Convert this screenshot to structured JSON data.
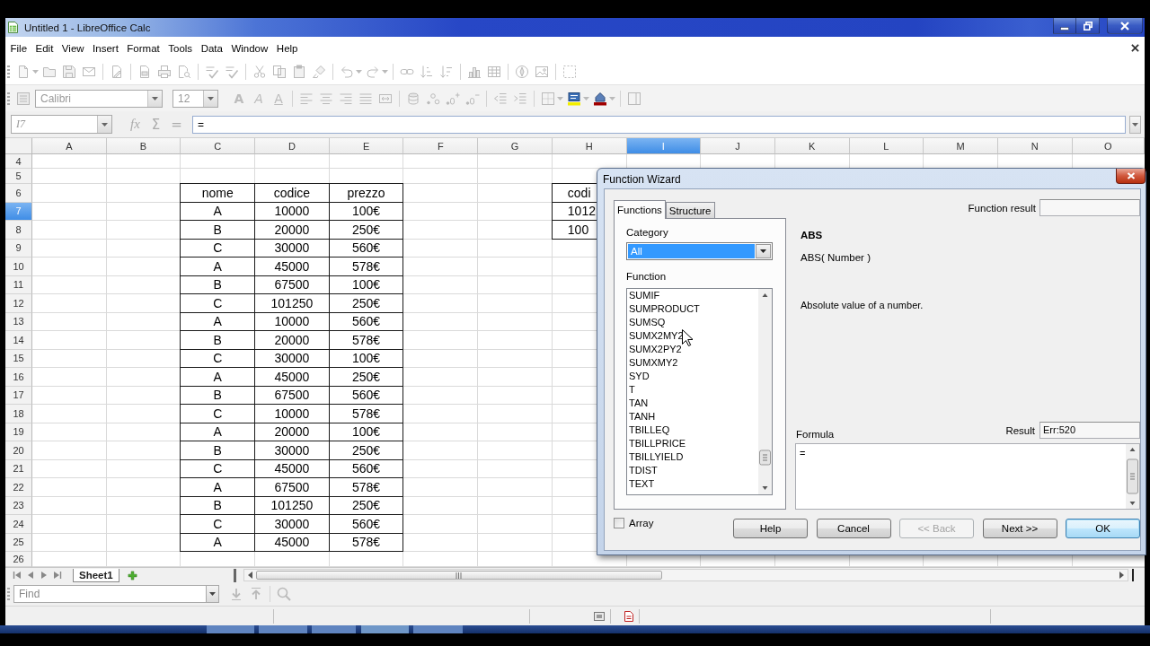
{
  "window": {
    "title": "Untitled 1 - LibreOffice Calc"
  },
  "menu": [
    "File",
    "Edit",
    "View",
    "Insert",
    "Format",
    "Tools",
    "Data",
    "Window",
    "Help"
  ],
  "standard_toolbar": {
    "disabled": true
  },
  "formatting_toolbar": {
    "font_name": "Calibri",
    "font_size": "12",
    "style_buttons": [
      {
        "kind": "bold",
        "label": "A"
      },
      {
        "kind": "italic",
        "label": "A"
      },
      {
        "kind": "underline",
        "label": "A"
      }
    ],
    "disabled": true
  },
  "formula_bar": {
    "cell_reference": "I7",
    "buttons": [
      {
        "kind": "wizard",
        "label": "fx"
      },
      {
        "kind": "sum",
        "label": "Σ"
      },
      {
        "kind": "function",
        "label": "="
      }
    ],
    "value": "=",
    "disabled": true
  },
  "sheet": {
    "columns": [
      {
        "label": "A",
        "selected": false
      },
      {
        "label": "B",
        "selected": false
      },
      {
        "label": "C",
        "selected": false
      },
      {
        "label": "D",
        "selected": false
      },
      {
        "label": "E",
        "selected": false
      },
      {
        "label": "F",
        "selected": false
      },
      {
        "label": "G",
        "selected": false
      },
      {
        "label": "H",
        "selected": false
      },
      {
        "label": "I",
        "selected": true
      },
      {
        "label": "J",
        "selected": false
      },
      {
        "label": "K",
        "selected": false
      },
      {
        "label": "L",
        "selected": false
      },
      {
        "label": "M",
        "selected": false
      },
      {
        "label": "N",
        "selected": false
      },
      {
        "label": "O",
        "selected": false
      }
    ],
    "rows": [
      {
        "label": "4",
        "selected": false
      },
      {
        "label": "5",
        "selected": false
      },
      {
        "label": "6",
        "selected": false
      },
      {
        "label": "7",
        "selected": true
      },
      {
        "label": "8",
        "selected": false
      },
      {
        "label": "9",
        "selected": false
      },
      {
        "label": "10",
        "selected": false
      },
      {
        "label": "11",
        "selected": false
      },
      {
        "label": "12",
        "selected": false
      },
      {
        "label": "13",
        "selected": false
      },
      {
        "label": "14",
        "selected": false
      },
      {
        "label": "15",
        "selected": false
      },
      {
        "label": "16",
        "selected": false
      },
      {
        "label": "17",
        "selected": false
      },
      {
        "label": "18",
        "selected": false
      },
      {
        "label": "19",
        "selected": false
      },
      {
        "label": "20",
        "selected": false
      },
      {
        "label": "21",
        "selected": false
      },
      {
        "label": "22",
        "selected": false
      },
      {
        "label": "23",
        "selected": false
      },
      {
        "label": "24",
        "selected": false
      },
      {
        "label": "25",
        "selected": false
      },
      {
        "label": "26",
        "selected": false
      }
    ]
  },
  "table": {
    "header": [
      "nome",
      "codice",
      "prezzo"
    ],
    "rows": [
      [
        "A",
        "10000",
        "100€"
      ],
      [
        "B",
        "20000",
        "250€"
      ],
      [
        "C",
        "30000",
        "560€"
      ],
      [
        "A",
        "45000",
        "578€"
      ],
      [
        "B",
        "67500",
        "100€"
      ],
      [
        "C",
        "101250",
        "250€"
      ],
      [
        "A",
        "10000",
        "560€"
      ],
      [
        "B",
        "20000",
        "578€"
      ],
      [
        "C",
        "30000",
        "100€"
      ],
      [
        "A",
        "45000",
        "250€"
      ],
      [
        "B",
        "67500",
        "560€"
      ],
      [
        "C",
        "10000",
        "578€"
      ],
      [
        "A",
        "20000",
        "100€"
      ],
      [
        "B",
        "30000",
        "250€"
      ],
      [
        "C",
        "45000",
        "560€"
      ],
      [
        "A",
        "67500",
        "578€"
      ],
      [
        "B",
        "101250",
        "250€"
      ],
      [
        "C",
        "30000",
        "560€"
      ],
      [
        "A",
        "45000",
        "578€"
      ]
    ]
  },
  "side_table": {
    "cells": [
      "codi",
      "1012",
      "100"
    ]
  },
  "sheet_tabs": [
    {
      "label": "Sheet1",
      "selected": true
    }
  ],
  "find_bar": {
    "placeholder": "Find",
    "disabled": true
  },
  "dialog": {
    "title": "Function Wizard",
    "tabs": [
      {
        "label": "Functions",
        "selected": true
      },
      {
        "label": "Structure",
        "selected": false
      }
    ],
    "category": {
      "label": "Category",
      "value": "All",
      "focused": true
    },
    "function_list": {
      "label": "Function",
      "items": [
        {
          "label": "SUMIF",
          "selected": false
        },
        {
          "label": "SUMPRODUCT",
          "selected": false
        },
        {
          "label": "SUMSQ",
          "selected": false
        },
        {
          "label": "SUMX2MY2",
          "selected": false
        },
        {
          "label": "SUMX2PY2",
          "selected": false
        },
        {
          "label": "SUMXMY2",
          "selected": false
        },
        {
          "label": "SYD",
          "selected": false
        },
        {
          "label": "T",
          "selected": false
        },
        {
          "label": "TAN",
          "selected": false
        },
        {
          "label": "TANH",
          "selected": false
        },
        {
          "label": "TBILLEQ",
          "selected": false
        },
        {
          "label": "TBILLPRICE",
          "selected": false
        },
        {
          "label": "TBILLYIELD",
          "selected": false
        },
        {
          "label": "TDIST",
          "selected": false
        },
        {
          "label": "TEXT",
          "selected": false
        }
      ]
    },
    "function_result": {
      "label": "Function result"
    },
    "function_name": "ABS",
    "signature": "ABS( Number )",
    "description": "Absolute value of a number.",
    "formula": {
      "label": "Formula",
      "value": "="
    },
    "result": {
      "label": "Result",
      "value": "Err:520"
    },
    "array": {
      "label": "Array",
      "checked": false
    },
    "buttons": [
      {
        "label": "Help",
        "disabled": false,
        "default": false
      },
      {
        "label": "Cancel",
        "disabled": false,
        "default": false
      },
      {
        "label": "<< Back",
        "disabled": true,
        "default": false
      },
      {
        "label": "Next >>",
        "disabled": false,
        "default": false
      },
      {
        "label": "OK",
        "disabled": false,
        "default": true
      }
    ]
  }
}
